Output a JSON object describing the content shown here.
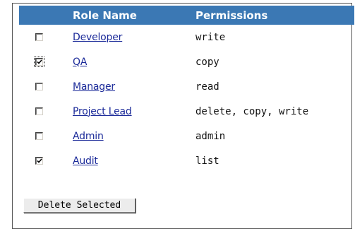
{
  "table": {
    "headers": {
      "role_name": "Role Name",
      "permissions": "Permissions"
    },
    "rows": [
      {
        "role": "Developer",
        "permissions": "write",
        "checked": false,
        "focused": false
      },
      {
        "role": "QA",
        "permissions": "copy",
        "checked": true,
        "focused": true
      },
      {
        "role": "Manager",
        "permissions": "read",
        "checked": false,
        "focused": false
      },
      {
        "role": "Project Lead",
        "permissions": "delete, copy, write",
        "checked": false,
        "focused": false
      },
      {
        "role": "Admin",
        "permissions": "admin",
        "checked": false,
        "focused": false
      },
      {
        "role": "Audit",
        "permissions": "list",
        "checked": true,
        "focused": false
      }
    ]
  },
  "actions": {
    "delete_selected_label": "Delete Selected"
  },
  "colors": {
    "header_bg": "#3b78b4",
    "link": "#1b2a99"
  }
}
